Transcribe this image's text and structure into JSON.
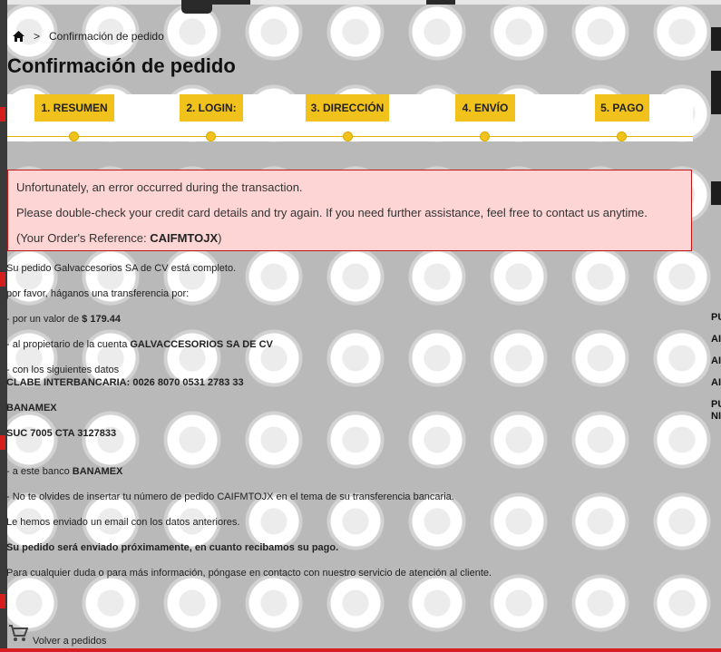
{
  "breadcrumb": {
    "current": "Confirmación de pedido",
    "separator": ">"
  },
  "page_title": "Confirmación de pedido",
  "steps": [
    "1. RESUMEN",
    "2. LOGIN:",
    "3. DIRECCIÓN",
    "4. ENVÍO",
    "5. PAGO"
  ],
  "alert": {
    "line1": "Unfortunately, an error occurred during the transaction.",
    "line2": "Please double-check your credit card details and try again. If you need further assistance, feel free to contact us anytime.",
    "ref_prefix": "(Your Order's Reference: ",
    "ref_code": "CAIFMTOJX",
    "ref_suffix": ")"
  },
  "order": {
    "complete": "Su pedido Galvaccesorios SA de CV está completo.",
    "transfer_intro": "por favor, háganos una transferencia por:",
    "amount_prefix": "- por un valor de ",
    "amount": "$ 179.44",
    "owner_prefix": "- al propietario de la cuenta ",
    "owner": "GALVACCESORIOS SA DE CV",
    "data_intro": "- con los siguientes datos",
    "clabe": "CLABE INTERBANCARIA: 0026 8070 0531 2783 33",
    "bank_name": "BANAMEX",
    "branch": "SUC 7005 CTA 3127833",
    "bank_prefix": "- a este banco ",
    "bank": "BANAMEX",
    "reminder": "- No te olvides de insertar tu número de pedido CAIFMTOJX en el tema de su transferencia bancaria.",
    "email_sent": "Le hemos enviado un email con los datos anteriores.",
    "shipping_note": "Su pedido será enviado próximamente, en cuanto recibamos su pago.",
    "contact_note": "Para cualquier duda o para más información, póngase en contacto con nuestro servicio de atención al cliente."
  },
  "back_link": "Volver a pedidos",
  "sidebar_fragments": [
    "PU",
    "AI",
    "AI",
    "AI",
    "PU",
    "NI"
  ],
  "icons": {
    "home": "home-icon",
    "cart": "cart-icon"
  },
  "colors": {
    "accent": "#f2c21c",
    "alert_bg": "#fdd5d5",
    "alert_border": "#c41313",
    "brand_red": "#d61e1e"
  }
}
